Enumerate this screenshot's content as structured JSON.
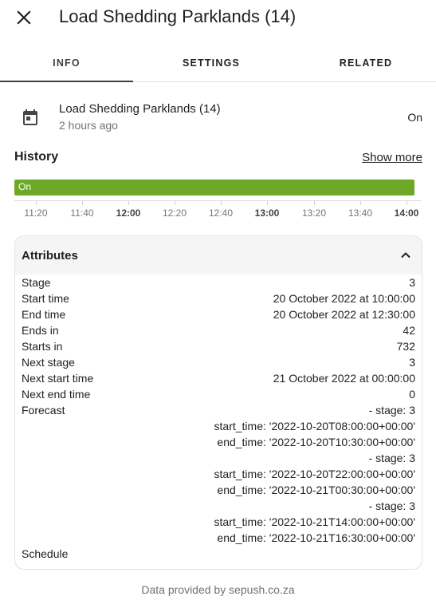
{
  "header": {
    "title": "Load Shedding Parklands (14)",
    "close_icon": "close-icon"
  },
  "tabs": [
    {
      "label": "INFO",
      "active": true
    },
    {
      "label": "SETTINGS",
      "active": false
    },
    {
      "label": "RELATED",
      "active": false
    }
  ],
  "entity": {
    "name": "Load Shedding Parklands (14)",
    "last_changed": "2 hours ago",
    "state": "On",
    "icon": "calendar-icon"
  },
  "history": {
    "title": "History",
    "show_more_label": "Show more",
    "bar_label": "On",
    "bar_color": "#6ea827",
    "ticks": [
      {
        "label": "11:20",
        "bold": false
      },
      {
        "label": "11:40",
        "bold": false
      },
      {
        "label": "12:00",
        "bold": true
      },
      {
        "label": "12:20",
        "bold": false
      },
      {
        "label": "12:40",
        "bold": false
      },
      {
        "label": "13:00",
        "bold": true
      },
      {
        "label": "13:20",
        "bold": false
      },
      {
        "label": "13:40",
        "bold": false
      },
      {
        "label": "14:00",
        "bold": true
      }
    ]
  },
  "attributes": {
    "title": "Attributes",
    "rows": [
      {
        "key": "Stage",
        "value": "3"
      },
      {
        "key": "Start time",
        "value": "20 October 2022 at 10:00:00"
      },
      {
        "key": "End time",
        "value": "20 October 2022 at 12:30:00"
      },
      {
        "key": "Ends in",
        "value": "42"
      },
      {
        "key": "Starts in",
        "value": "732"
      },
      {
        "key": "Next stage",
        "value": "3"
      },
      {
        "key": "Next start time",
        "value": "21 October 2022 at 00:00:00"
      },
      {
        "key": "Next end time",
        "value": "0"
      },
      {
        "key": "Forecast",
        "value": "- stage: 3"
      },
      {
        "key": "",
        "value": "start_time: '2022-10-20T08:00:00+00:00'"
      },
      {
        "key": "",
        "value": "end_time: '2022-10-20T10:30:00+00:00'"
      },
      {
        "key": "",
        "value": "- stage: 3"
      },
      {
        "key": "",
        "value": "start_time: '2022-10-20T22:00:00+00:00'"
      },
      {
        "key": "",
        "value": "end_time: '2022-10-21T00:30:00+00:00'"
      },
      {
        "key": "",
        "value": "- stage: 3"
      },
      {
        "key": "",
        "value": "start_time: '2022-10-21T14:00:00+00:00'"
      },
      {
        "key": "",
        "value": "end_time: '2022-10-21T16:30:00+00:00'"
      },
      {
        "key": "Schedule",
        "value": ""
      }
    ]
  },
  "footer": {
    "text": "Data provided by sepush.co.za"
  }
}
